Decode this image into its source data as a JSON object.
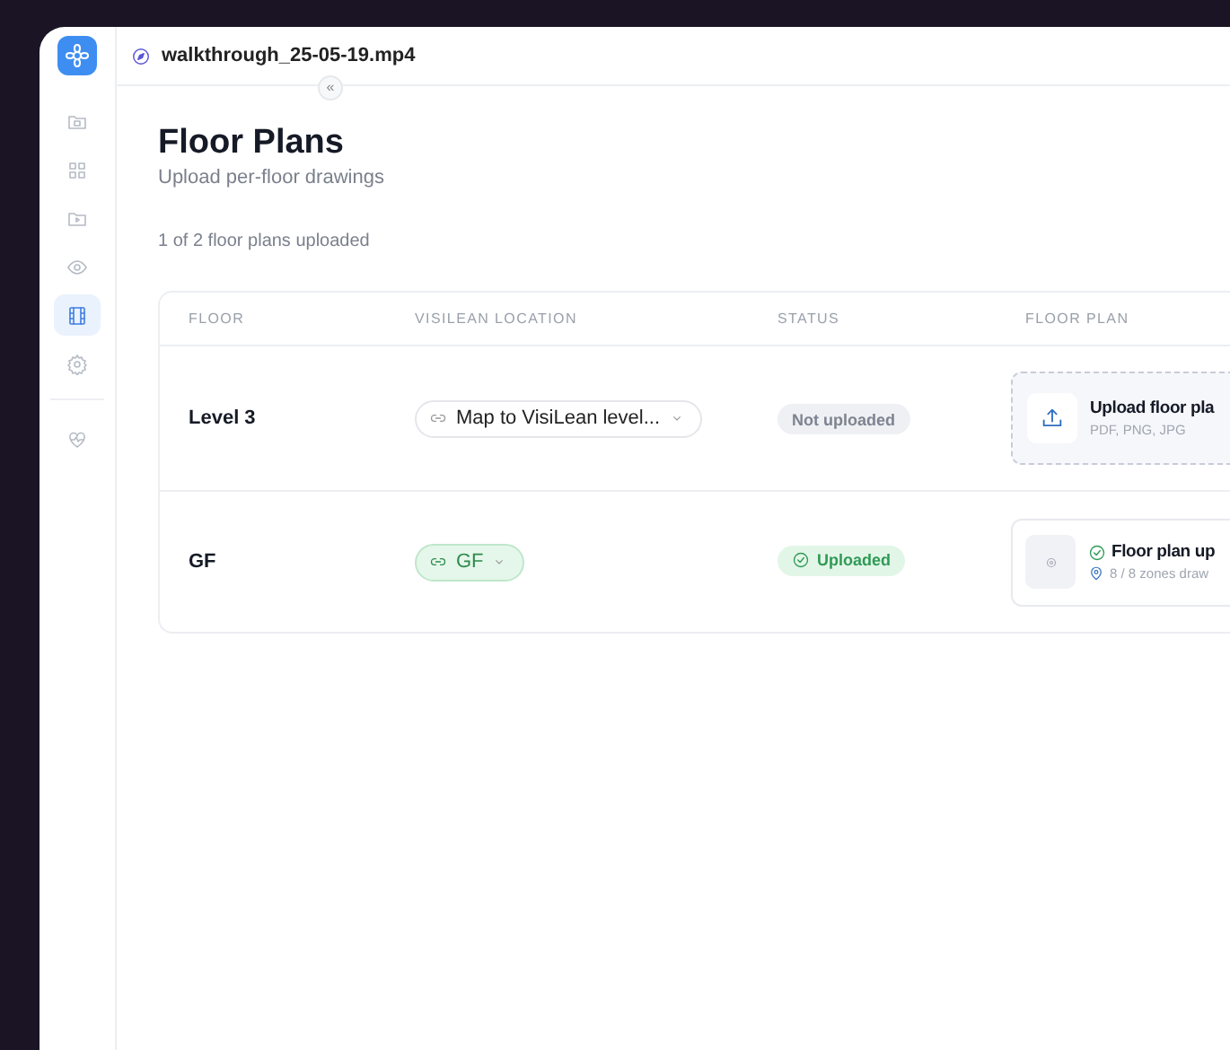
{
  "window": {
    "title": "walkthrough_25-05-19.mp4"
  },
  "sidebar": {
    "items": [
      {
        "selected": false
      },
      {
        "selected": false
      },
      {
        "selected": false
      },
      {
        "selected": false
      },
      {
        "selected": true
      },
      {
        "selected": false
      },
      {
        "selected": false
      }
    ]
  },
  "collapse": {
    "label": "«"
  },
  "page": {
    "title": "Floor Plans",
    "subtitle": "Upload per-floor drawings",
    "summary": "1 of 2 floor plans uploaded"
  },
  "table": {
    "columns": [
      "FLOOR",
      "VISILEAN LOCATION",
      "STATUS",
      "FLOOR PLAN"
    ],
    "rows": [
      {
        "floor": "Level 3",
        "location": {
          "label": "Map to VisiLean level...",
          "mapped": false
        },
        "status": {
          "kind": "not_uploaded",
          "label": "Not uploaded"
        },
        "plan": {
          "kind": "upload",
          "title": "Upload floor pla",
          "hint": "PDF, PNG, JPG"
        }
      },
      {
        "floor": "GF",
        "location": {
          "label": "GF",
          "mapped": true
        },
        "status": {
          "kind": "uploaded",
          "label": "Uploaded"
        },
        "plan": {
          "kind": "uploaded",
          "title": "Floor plan up",
          "hint": "8 / 8 zones draw"
        }
      }
    ]
  }
}
